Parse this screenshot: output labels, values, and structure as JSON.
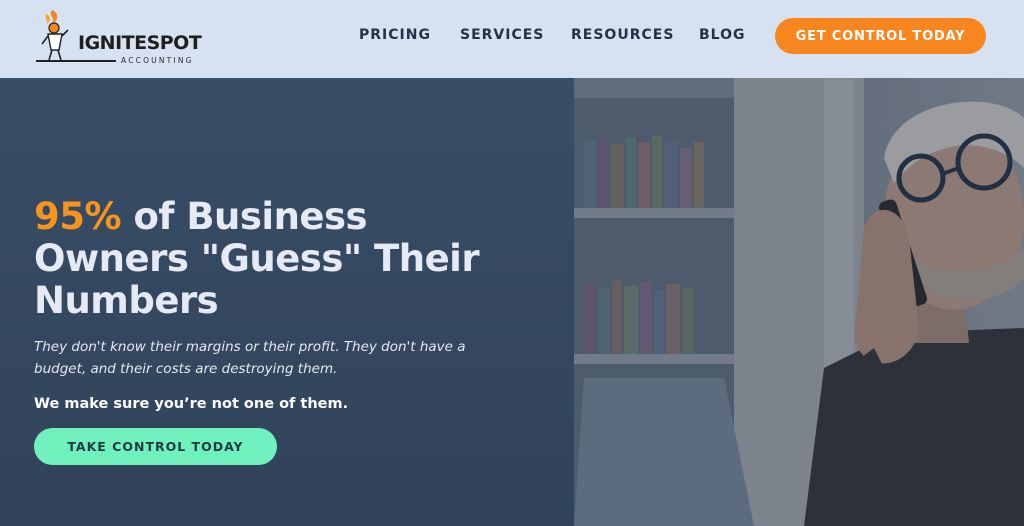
{
  "header": {
    "logo": {
      "name": "IGNITESPOT",
      "sub": "ACCOUNTING"
    },
    "nav": [
      {
        "label": "PRICING"
      },
      {
        "label": "SERVICES"
      },
      {
        "label": "RESOURCES"
      },
      {
        "label": "BLOG"
      }
    ],
    "cta_label": "GET CONTROL TODAY"
  },
  "hero": {
    "headline_accent": "95%",
    "headline_line1": " of Business",
    "headline_line2": "Owners \"Guess\" Their",
    "headline_line3": "Numbers",
    "subtext": "They don't know their margins or their profit. They don't have a budget, and their costs are destroying them.",
    "tagline": "We make sure you’re not one of them.",
    "cta_label": "TAKE CONTROL TODAY"
  },
  "colors": {
    "header_bg": "#d6e2f2",
    "nav_text": "#243246",
    "brand_orange": "#f7861e",
    "hero_bg": "#34475f",
    "cta_green": "#6ff0bc"
  }
}
